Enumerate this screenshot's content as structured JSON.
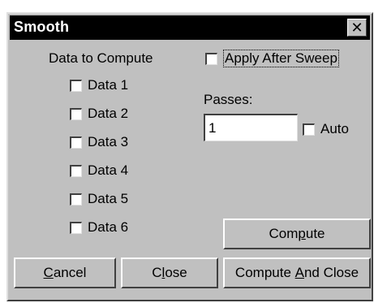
{
  "window": {
    "title": "Smooth",
    "close_glyph": "✕"
  },
  "data_group": {
    "label": "Data to Compute",
    "items": [
      {
        "label": "Data 1",
        "checked": false
      },
      {
        "label": "Data 2",
        "checked": false
      },
      {
        "label": "Data 3",
        "checked": false
      },
      {
        "label": "Data 4",
        "checked": false
      },
      {
        "label": "Data 5",
        "checked": false
      },
      {
        "label": "Data 6",
        "checked": false
      }
    ]
  },
  "apply_after_sweep": {
    "label": "Apply After Sweep",
    "checked": false
  },
  "passes": {
    "label": "Passes:",
    "value": "1",
    "auto_label": "Auto",
    "auto_checked": false
  },
  "buttons": {
    "compute": {
      "pre": "Com",
      "mnemonic": "p",
      "post": "ute"
    },
    "cancel": {
      "pre": "",
      "mnemonic": "C",
      "post": "ancel"
    },
    "close": {
      "pre": "C",
      "mnemonic": "l",
      "post": "ose"
    },
    "compute_and_close": {
      "pre": "Compute ",
      "mnemonic": "A",
      "post": "nd Close"
    }
  },
  "colors": {
    "dialog_face": "#c0c0c0",
    "titlebar": "#000000",
    "title_text": "#ffffff"
  }
}
